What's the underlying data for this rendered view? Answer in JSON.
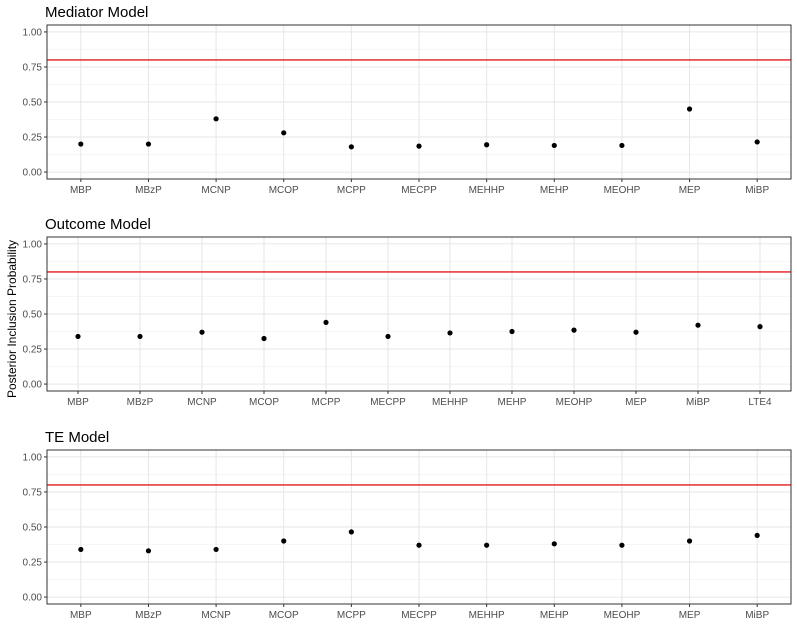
{
  "chart_data": {
    "type": "scatter",
    "ylabel": "Posterior Inclusion Probability",
    "ylim": [
      0,
      1
    ],
    "yticks": [
      "0.00",
      "0.25",
      "0.50",
      "0.75",
      "1.00"
    ],
    "threshold": 0.8,
    "threshold_color": "#e41a1c",
    "point_color": "#000000",
    "grid": true,
    "panels": [
      {
        "title": "Mediator Model",
        "categories": [
          "MBP",
          "MBzP",
          "MCNP",
          "MCOP",
          "MCPP",
          "MECPP",
          "MEHHP",
          "MEHP",
          "MEOHP",
          "MEP",
          "MiBP"
        ],
        "values": [
          0.2,
          0.2,
          0.38,
          0.28,
          0.18,
          0.185,
          0.195,
          0.19,
          0.19,
          0.45,
          0.215
        ]
      },
      {
        "title": "Outcome Model",
        "categories": [
          "MBP",
          "MBzP",
          "MCNP",
          "MCOP",
          "MCPP",
          "MECPP",
          "MEHHP",
          "MEHP",
          "MEOHP",
          "MEP",
          "MiBP",
          "LTE4"
        ],
        "values": [
          0.34,
          0.34,
          0.37,
          0.325,
          0.44,
          0.34,
          0.365,
          0.375,
          0.385,
          0.37,
          0.42,
          0.41
        ]
      },
      {
        "title": "TE Model",
        "categories": [
          "MBP",
          "MBzP",
          "MCNP",
          "MCOP",
          "MCPP",
          "MECPP",
          "MEHHP",
          "MEHP",
          "MEOHP",
          "MEP",
          "MiBP"
        ],
        "values": [
          0.34,
          0.33,
          0.34,
          0.4,
          0.465,
          0.37,
          0.37,
          0.38,
          0.37,
          0.4,
          0.44
        ]
      }
    ]
  }
}
